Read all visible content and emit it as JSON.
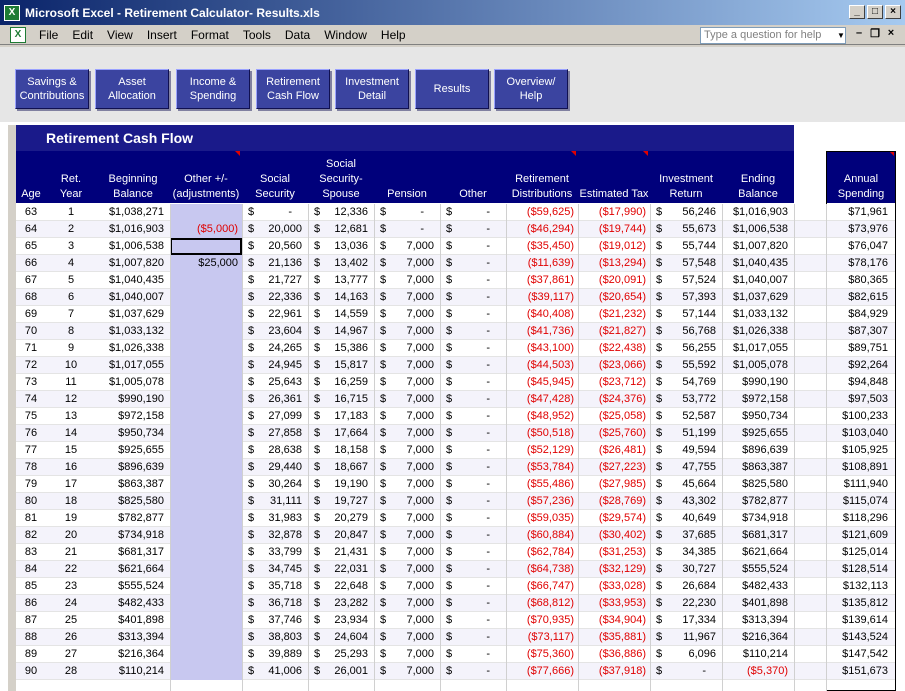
{
  "window": {
    "title": "Microsoft Excel - Retirement Calculator- Results.xls"
  },
  "menu": {
    "items": [
      "File",
      "Edit",
      "View",
      "Insert",
      "Format",
      "Tools",
      "Data",
      "Window",
      "Help"
    ],
    "ask_placeholder": "Type a question for help"
  },
  "nav_buttons": [
    "Savings &\nContributions",
    "Asset\nAllocation",
    "Income &\nSpending",
    "Retirement\nCash Flow",
    "Investment\nDetail",
    "Results",
    "Overview/\nHelp"
  ],
  "sheet": {
    "banner": "Retirement Cash Flow",
    "headers": {
      "age": "Age",
      "ret_year": "Ret.\nYear",
      "beginning_balance": "Beginning\nBalance",
      "other_adj": "Other +/-\n(adjustments)",
      "social_security": "Social\nSecurity",
      "ss_spouse": "Social\nSecurity-\nSpouse",
      "pension": "Pension",
      "other": "Other",
      "retirement_distributions": "Retirement\nDistributions",
      "estimated_tax": "Estimated Tax",
      "investment_return": "Investment\nReturn",
      "ending_balance": "Ending\nBalance",
      "annual_spending": "Annual\nSpending"
    },
    "rows": [
      [
        "63",
        "1",
        "$1,038,271",
        "",
        "-",
        "12,336",
        "-",
        "-",
        "($59,625)",
        "($17,990)",
        "56,246",
        "$1,016,903",
        "$71,961"
      ],
      [
        "64",
        "2",
        "$1,016,903",
        "($5,000)",
        "20,000",
        "12,681",
        "-",
        "-",
        "($46,294)",
        "($19,744)",
        "55,673",
        "$1,006,538",
        "$73,976"
      ],
      [
        "65",
        "3",
        "$1,006,538",
        "",
        "20,560",
        "13,036",
        "7,000",
        "-",
        "($35,450)",
        "($19,012)",
        "55,744",
        "$1,007,820",
        "$76,047"
      ],
      [
        "66",
        "4",
        "$1,007,820",
        "$25,000",
        "21,136",
        "13,402",
        "7,000",
        "-",
        "($11,639)",
        "($13,294)",
        "57,548",
        "$1,040,435",
        "$78,176"
      ],
      [
        "67",
        "5",
        "$1,040,435",
        "",
        "21,727",
        "13,777",
        "7,000",
        "-",
        "($37,861)",
        "($20,091)",
        "57,524",
        "$1,040,007",
        "$80,365"
      ],
      [
        "68",
        "6",
        "$1,040,007",
        "",
        "22,336",
        "14,163",
        "7,000",
        "-",
        "($39,117)",
        "($20,654)",
        "57,393",
        "$1,037,629",
        "$82,615"
      ],
      [
        "69",
        "7",
        "$1,037,629",
        "",
        "22,961",
        "14,559",
        "7,000",
        "-",
        "($40,408)",
        "($21,232)",
        "57,144",
        "$1,033,132",
        "$84,929"
      ],
      [
        "70",
        "8",
        "$1,033,132",
        "",
        "23,604",
        "14,967",
        "7,000",
        "-",
        "($41,736)",
        "($21,827)",
        "56,768",
        "$1,026,338",
        "$87,307"
      ],
      [
        "71",
        "9",
        "$1,026,338",
        "",
        "24,265",
        "15,386",
        "7,000",
        "-",
        "($43,100)",
        "($22,438)",
        "56,255",
        "$1,017,055",
        "$89,751"
      ],
      [
        "72",
        "10",
        "$1,017,055",
        "",
        "24,945",
        "15,817",
        "7,000",
        "-",
        "($44,503)",
        "($23,066)",
        "55,592",
        "$1,005,078",
        "$92,264"
      ],
      [
        "73",
        "11",
        "$1,005,078",
        "",
        "25,643",
        "16,259",
        "7,000",
        "-",
        "($45,945)",
        "($23,712)",
        "54,769",
        "$990,190",
        "$94,848"
      ],
      [
        "74",
        "12",
        "$990,190",
        "",
        "26,361",
        "16,715",
        "7,000",
        "-",
        "($47,428)",
        "($24,376)",
        "53,772",
        "$972,158",
        "$97,503"
      ],
      [
        "75",
        "13",
        "$972,158",
        "",
        "27,099",
        "17,183",
        "7,000",
        "-",
        "($48,952)",
        "($25,058)",
        "52,587",
        "$950,734",
        "$100,233"
      ],
      [
        "76",
        "14",
        "$950,734",
        "",
        "27,858",
        "17,664",
        "7,000",
        "-",
        "($50,518)",
        "($25,760)",
        "51,199",
        "$925,655",
        "$103,040"
      ],
      [
        "77",
        "15",
        "$925,655",
        "",
        "28,638",
        "18,158",
        "7,000",
        "-",
        "($52,129)",
        "($26,481)",
        "49,594",
        "$896,639",
        "$105,925"
      ],
      [
        "78",
        "16",
        "$896,639",
        "",
        "29,440",
        "18,667",
        "7,000",
        "-",
        "($53,784)",
        "($27,223)",
        "47,755",
        "$863,387",
        "$108,891"
      ],
      [
        "79",
        "17",
        "$863,387",
        "",
        "30,264",
        "19,190",
        "7,000",
        "-",
        "($55,486)",
        "($27,985)",
        "45,664",
        "$825,580",
        "$111,940"
      ],
      [
        "80",
        "18",
        "$825,580",
        "",
        "31,111",
        "19,727",
        "7,000",
        "-",
        "($57,236)",
        "($28,769)",
        "43,302",
        "$782,877",
        "$115,074"
      ],
      [
        "81",
        "19",
        "$782,877",
        "",
        "31,983",
        "20,279",
        "7,000",
        "-",
        "($59,035)",
        "($29,574)",
        "40,649",
        "$734,918",
        "$118,296"
      ],
      [
        "82",
        "20",
        "$734,918",
        "",
        "32,878",
        "20,847",
        "7,000",
        "-",
        "($60,884)",
        "($30,402)",
        "37,685",
        "$681,317",
        "$121,609"
      ],
      [
        "83",
        "21",
        "$681,317",
        "",
        "33,799",
        "21,431",
        "7,000",
        "-",
        "($62,784)",
        "($31,253)",
        "34,385",
        "$621,664",
        "$125,014"
      ],
      [
        "84",
        "22",
        "$621,664",
        "",
        "34,745",
        "22,031",
        "7,000",
        "-",
        "($64,738)",
        "($32,129)",
        "30,727",
        "$555,524",
        "$128,514"
      ],
      [
        "85",
        "23",
        "$555,524",
        "",
        "35,718",
        "22,648",
        "7,000",
        "-",
        "($66,747)",
        "($33,028)",
        "26,684",
        "$482,433",
        "$132,113"
      ],
      [
        "86",
        "24",
        "$482,433",
        "",
        "36,718",
        "23,282",
        "7,000",
        "-",
        "($68,812)",
        "($33,953)",
        "22,230",
        "$401,898",
        "$135,812"
      ],
      [
        "87",
        "25",
        "$401,898",
        "",
        "37,746",
        "23,934",
        "7,000",
        "-",
        "($70,935)",
        "($34,904)",
        "17,334",
        "$313,394",
        "$139,614"
      ],
      [
        "88",
        "26",
        "$313,394",
        "",
        "38,803",
        "24,604",
        "7,000",
        "-",
        "($73,117)",
        "($35,881)",
        "11,967",
        "$216,364",
        "$143,524"
      ],
      [
        "89",
        "27",
        "$216,364",
        "",
        "39,889",
        "25,293",
        "7,000",
        "-",
        "($75,360)",
        "($36,886)",
        "6,096",
        "$110,214",
        "$147,542"
      ],
      [
        "90",
        "28",
        "$110,214",
        "",
        "41,006",
        "26,001",
        "7,000",
        "-",
        "($77,666)",
        "($37,918)",
        "-",
        "($5,370)",
        "$151,673"
      ]
    ]
  }
}
